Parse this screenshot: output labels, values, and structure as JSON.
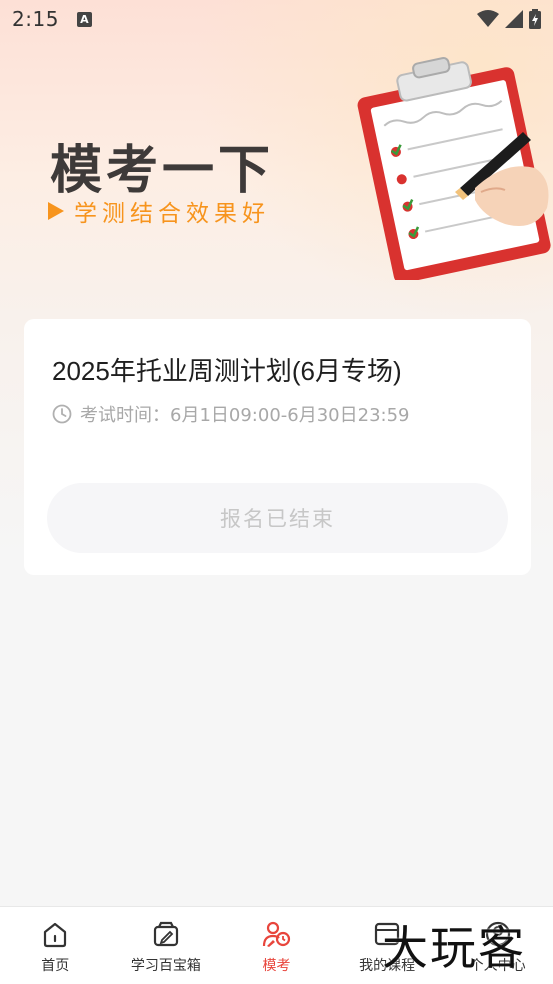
{
  "status_bar": {
    "time": "2:15",
    "notification_icon": "a-icon",
    "icons": [
      "wifi-icon",
      "signal-icon",
      "battery-icon"
    ]
  },
  "hero": {
    "title": "模考一下",
    "subtitle": "学测结合效果好"
  },
  "exam_card": {
    "title": "2025年托业周测计划(6月专场)",
    "time_label": "考试时间：",
    "time_value": "6月1日09:00-6月30日23:59",
    "button_label": "报名已结束"
  },
  "bottom_nav": {
    "items": [
      {
        "label": "首页",
        "icon": "home-icon"
      },
      {
        "label": "学习百宝箱",
        "icon": "toolbox-icon"
      },
      {
        "label": "模考",
        "icon": "exam-icon",
        "active": true
      },
      {
        "label": "我的课程",
        "icon": "courses-icon"
      },
      {
        "label": "个人中心",
        "icon": "profile-icon"
      }
    ],
    "active_color": "#e8453c"
  },
  "watermark": "大玩客",
  "colors": {
    "accent": "#f7941d",
    "nav_active": "#e8453c",
    "title_dark": "#3e3a39"
  }
}
